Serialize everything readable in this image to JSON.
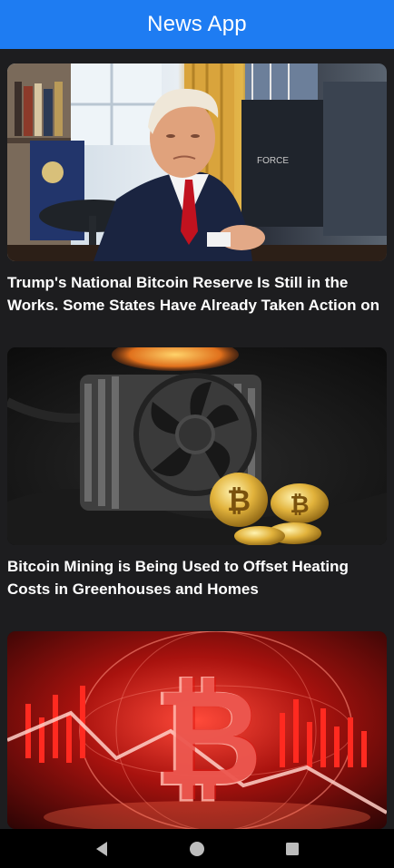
{
  "app_bar": {
    "title": "News App"
  },
  "articles": [
    {
      "image": "trump-oval-office-photo",
      "headline_lines": [
        "Trump's National Bitcoin Reserve Is Still in the",
        "Works. Some States Have Already Taken Action on"
      ]
    },
    {
      "image": "cpu-fan-bitcoin-coins-photo",
      "headline_lines": [
        "Bitcoin Mining is Being Used to Offset Heating",
        "Costs in Greenhouses and Homes"
      ]
    },
    {
      "image": "red-bitcoin-crash-graphic",
      "headline_lines": []
    }
  ],
  "nav": {
    "back_icon": "back-triangle-icon",
    "home_icon": "home-circle-icon",
    "recents_icon": "recents-square-icon"
  },
  "colors": {
    "app_bar": "#1e7cf2",
    "background": "#1d1d1f",
    "nav_bar": "#000000"
  }
}
